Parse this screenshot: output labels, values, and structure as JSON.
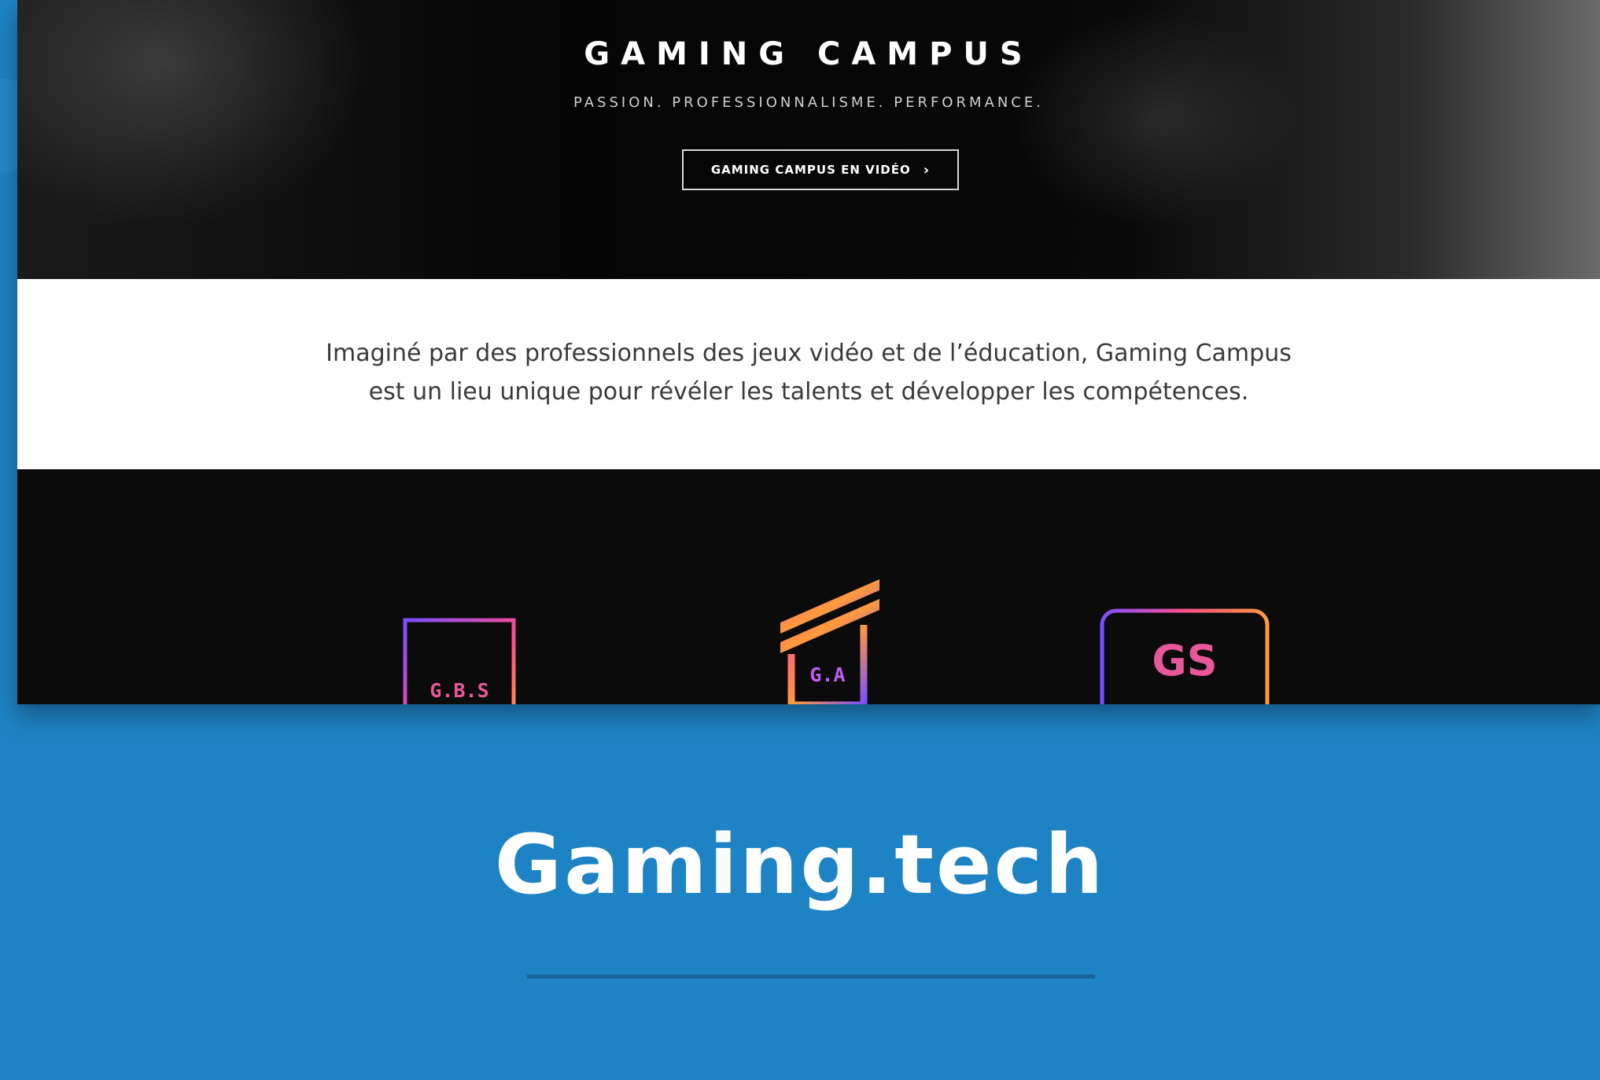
{
  "hero": {
    "title": "GAMING CAMPUS",
    "tagline": "PASSION. PROFESSIONNALISME. PERFORMANCE.",
    "cta_label": "GAMING CAMPUS EN VIDÉO",
    "cta_icon": "chevron-right-icon"
  },
  "intro": {
    "line1": "Imaginé par des professionnels des jeux vidéo et de l’éducation, Gaming Campus",
    "line2": "est un lieu unique pour révéler les talents et développer les compétences."
  },
  "schools": [
    {
      "logo_text": "G.B.S"
    },
    {
      "logo_text": "G.A"
    },
    {
      "logo_text": "GS"
    }
  ],
  "caption": {
    "title": "Gaming.tech"
  },
  "colors": {
    "background_blue": "#1e83c4",
    "divider_blue": "#1a6398",
    "logo_gradient_start": "#7a4dff",
    "logo_gradient_end": "#ff9a3c"
  }
}
